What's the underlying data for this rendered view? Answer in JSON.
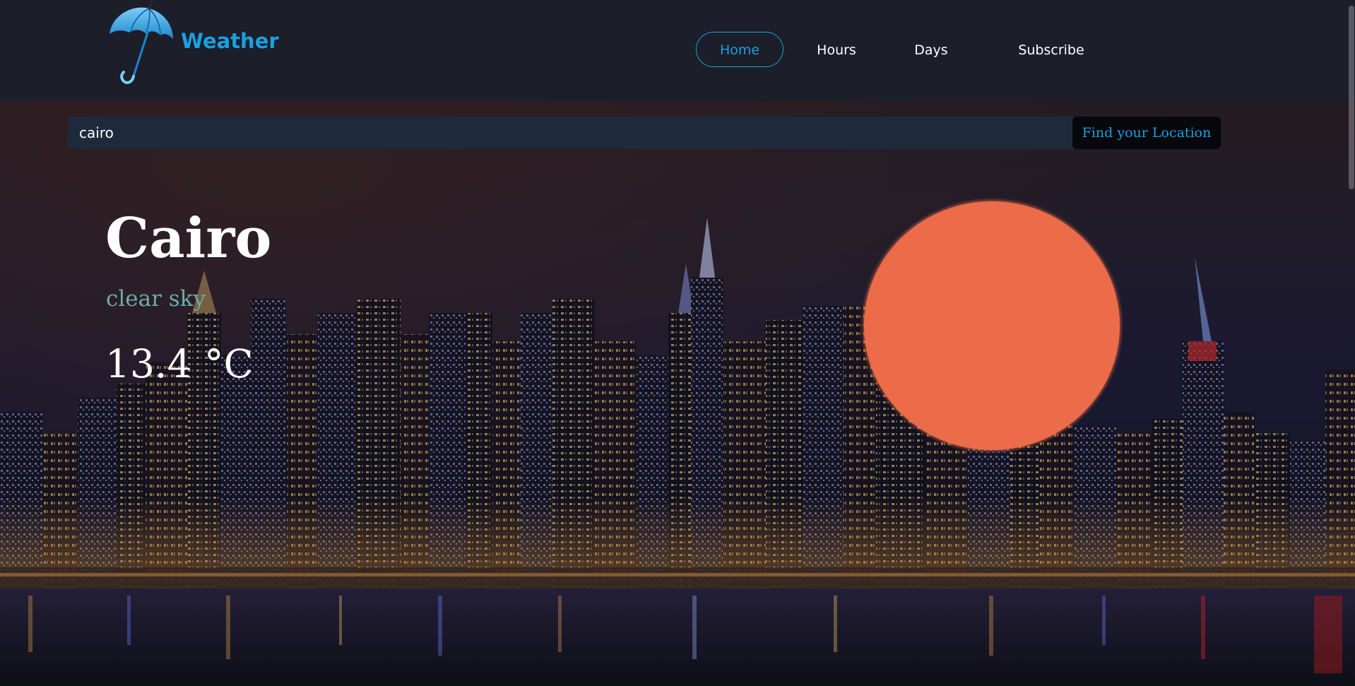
{
  "brand": {
    "name": "Weather",
    "logo_icon": "umbrella-icon"
  },
  "nav": {
    "items": [
      {
        "label": "Home",
        "active": true
      },
      {
        "label": "Hours",
        "active": false
      },
      {
        "label": "Days",
        "active": false
      },
      {
        "label": "Subscribe",
        "active": false
      }
    ]
  },
  "search": {
    "value": "cairo",
    "button_label": "Find your Location"
  },
  "weather": {
    "city": "Cairo",
    "condition": "clear sky",
    "temperature": "13.4 °C",
    "icon": "sun-icon"
  },
  "colors": {
    "accent": "#1aa0e0",
    "navbar_bg": "#1c1e2a",
    "condition_text": "#6eaaa8",
    "sun": "#ec6c49",
    "search_bg": "#1e2a3c",
    "button_bg": "#06080c"
  }
}
